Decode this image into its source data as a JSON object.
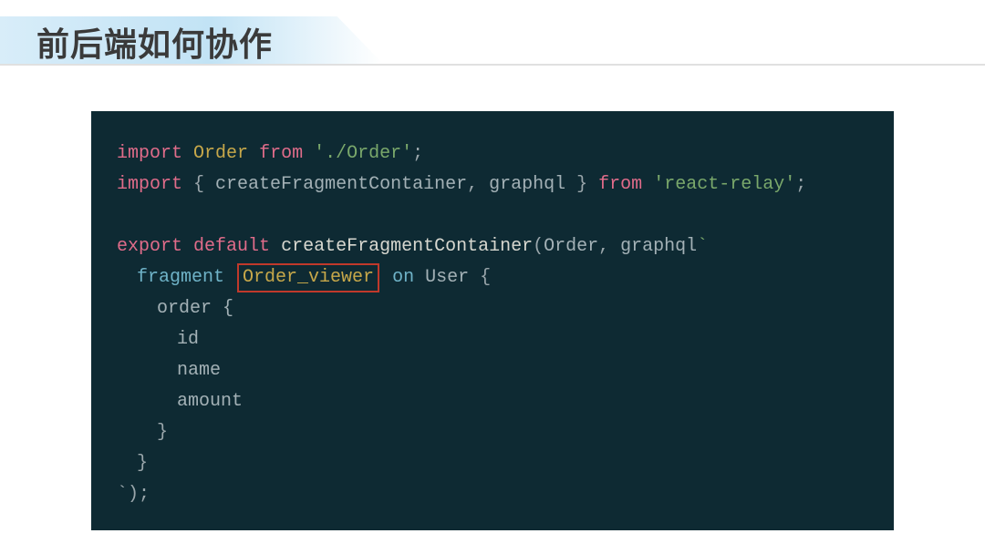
{
  "title": "前后端如何协作",
  "code": {
    "import1": {
      "kw_import": "import",
      "name": "Order",
      "kw_from": "from",
      "path": "'./Order'",
      "semi": ";"
    },
    "import2": {
      "kw_import": "import",
      "brace_l": "{ ",
      "n1": "createFragmentContainer",
      "comma": ", ",
      "n2": "graphql",
      "brace_r": " }",
      "kw_from": "from",
      "path": "'react-relay'",
      "semi": ";"
    },
    "export": {
      "kw_export": "export",
      "kw_default": "default",
      "fn": "createFragmentContainer",
      "paren_l": "(",
      "arg1": "Order",
      "comma": ", ",
      "arg2": "graphql",
      "backtick": "`"
    },
    "frag": {
      "kw": "fragment",
      "name": "Order_viewer",
      "on": "on",
      "type": "User",
      "brace": "{"
    },
    "field_order": "order {",
    "field_id": "id",
    "field_name": "name",
    "field_amount": "amount",
    "close_brace": "}",
    "close_tpl": "`);"
  }
}
